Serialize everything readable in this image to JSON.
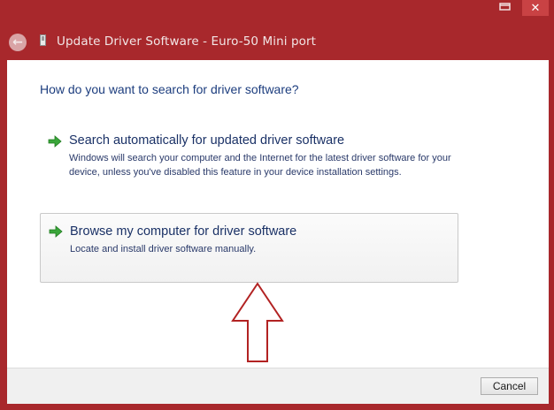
{
  "window": {
    "title": "Update Driver Software - Euro-50 Mini port",
    "close_glyph": "✕",
    "back_glyph": "←"
  },
  "main": {
    "question": "How do you want to search for driver software?",
    "options": [
      {
        "title": "Search automatically for updated driver software",
        "description": "Windows will search your computer and the Internet for the latest driver software for your device, unless you've disabled this feature in your device installation settings."
      },
      {
        "title": "Browse my computer for driver software",
        "description": "Locate and install driver software manually."
      }
    ]
  },
  "footer": {
    "cancel_label": "Cancel"
  },
  "colors": {
    "frame": "#a8282c",
    "heading_text": "#1c3d7e",
    "arrow_green": "#3aa63a",
    "annotation_arrow": "#b22222"
  },
  "icons": {
    "option_arrow": "green-arrow-icon",
    "back": "back-arrow-icon",
    "device": "device-icon",
    "annotation": "up-arrow-annotation"
  }
}
